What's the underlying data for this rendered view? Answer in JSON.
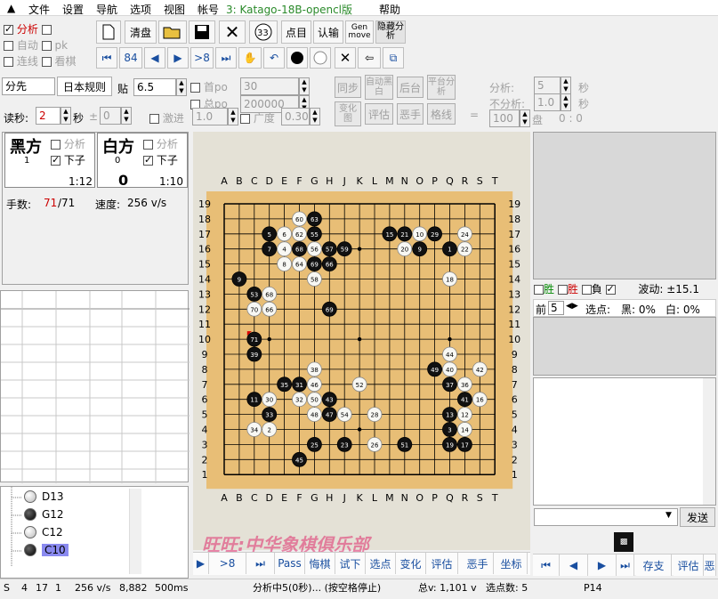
{
  "menu": {
    "file": "文件",
    "settings": "设置",
    "nav": "导航",
    "options": "选项",
    "view": "视图",
    "account": "帐号",
    "engine": "3: Katago-18B-opencl版",
    "help": "帮助"
  },
  "left_checks": {
    "analyze": "分析",
    "auto": "自动",
    "pk": "pk",
    "continuous": "连线",
    "watch": "看棋"
  },
  "toolbar": {
    "clear": "清盘",
    "score": "点目",
    "resign": "认输",
    "genmove": "Gen move",
    "hide_analysis": "隐藏分析",
    "move_num": "84",
    "to_eight": ">8"
  },
  "row2": {
    "handicap": "分先",
    "rules": "日本规则",
    "komi_label": "贴",
    "komi": "6.5",
    "first_po": "首po",
    "first_po_val": "30",
    "total_po": "总po",
    "total_po_val": "200000",
    "read_sec": "读秒:",
    "read_val": "2",
    "sec": "秒",
    "pm": "±",
    "pm_val": "0",
    "advance": "激进",
    "advance_val": "1.0",
    "breadth": "广度",
    "breadth_val": "0.30"
  },
  "row2_btns": {
    "sync": "同步",
    "auto_black": "自动黑白",
    "backstage": "后台",
    "flat_analysis": "平台分析",
    "variation": "变化图",
    "evaluate": "评估",
    "bad_move": "恶手",
    "grid": "格线"
  },
  "row2_right": {
    "analysis": "分析:",
    "analysis_val": "5",
    "sec": "秒",
    "no_analysis": "不分析:",
    "no_val": "1.0",
    "sec2": "秒",
    "games": "100",
    "games_unit": "盘",
    "score": "0 : 0"
  },
  "players": {
    "black": "黑方",
    "black_num": "1",
    "white": "白方",
    "white_num": "0",
    "analyze": "分析",
    "play": "下子",
    "black_time": "1:12",
    "black_score": "",
    "white_score": "0",
    "white_time": "1:10"
  },
  "moves": {
    "label": "手数:",
    "current": "71",
    "total": "/71",
    "speed_label": "速度:",
    "speed": "256 v/s"
  },
  "tree": [
    {
      "label": "D13",
      "color": "white"
    },
    {
      "label": "G12",
      "color": "black"
    },
    {
      "label": "C12",
      "color": "white"
    },
    {
      "label": "C10",
      "color": "black"
    }
  ],
  "coords": {
    "letters": [
      "A",
      "B",
      "C",
      "D",
      "E",
      "F",
      "G",
      "H",
      "J",
      "K",
      "L",
      "M",
      "N",
      "O",
      "P",
      "Q",
      "R",
      "S",
      "T"
    ]
  },
  "watermark": "旺旺:中华象棋俱乐部",
  "bottom_tabs": {
    "pass": "Pass",
    "undo": "悔棋",
    "try": "试下",
    "points": "选点",
    "change": "变化",
    "evaluate": "评估",
    "bad": "恶手",
    "coord": "坐标",
    "p8": ">8"
  },
  "right": {
    "win": "胜",
    "lose": "胜",
    "neg": "負",
    "wave_label": "波动:",
    "wave": "±15.1",
    "front": "前",
    "front_val": "5",
    "pick": "选点:",
    "black_pct": "黑: 0%",
    "white_pct": "白: 0%",
    "send": "发送",
    "save": "存支",
    "evaluate": "评估",
    "bad": "恶"
  },
  "status": {
    "s": "S",
    "a": "4",
    "b": "17",
    "c": "1",
    "speed": "256 v/s",
    "nodes": "8,882",
    "ms": "500ms",
    "analyzing": "分析中5(0秒)... (按空格停止)",
    "total": "总v: 1,101 v",
    "points": "选点数: 5",
    "pos": "P14"
  },
  "stones": [
    {
      "p": "F18",
      "c": "w",
      "n": "60"
    },
    {
      "p": "G18",
      "c": "b",
      "n": "63"
    },
    {
      "p": "D17",
      "c": "b",
      "n": "5"
    },
    {
      "p": "E17",
      "c": "w",
      "n": "6"
    },
    {
      "p": "F17",
      "c": "w",
      "n": "62"
    },
    {
      "p": "G17",
      "c": "b",
      "n": "55"
    },
    {
      "p": "M17",
      "c": "b",
      "n": "15"
    },
    {
      "p": "N17",
      "c": "b",
      "n": "21"
    },
    {
      "p": "O17",
      "c": "w",
      "n": "10"
    },
    {
      "p": "P17",
      "c": "b",
      "n": "29"
    },
    {
      "p": "R17",
      "c": "w",
      "n": "24"
    },
    {
      "p": "D16",
      "c": "b",
      "n": "7"
    },
    {
      "p": "E16",
      "c": "w",
      "n": "4"
    },
    {
      "p": "F16",
      "c": "b",
      "n": "68"
    },
    {
      "p": "G16",
      "c": "w",
      "n": "56"
    },
    {
      "p": "H16",
      "c": "b",
      "n": "57"
    },
    {
      "p": "J16",
      "c": "b",
      "n": "59"
    },
    {
      "p": "N16",
      "c": "w",
      "n": "20"
    },
    {
      "p": "O16",
      "c": "b",
      "n": "9"
    },
    {
      "p": "Q16",
      "c": "b",
      "n": "1"
    },
    {
      "p": "R16",
      "c": "w",
      "n": "22"
    },
    {
      "p": "E15",
      "c": "w",
      "n": "8"
    },
    {
      "p": "F15",
      "c": "w",
      "n": "64"
    },
    {
      "p": "G15",
      "c": "b",
      "n": "69"
    },
    {
      "p": "H15",
      "c": "b",
      "n": "66"
    },
    {
      "p": "B14",
      "c": "b",
      "n": "9"
    },
    {
      "p": "G14",
      "c": "w",
      "n": "58"
    },
    {
      "p": "Q14",
      "c": "w",
      "n": "18"
    },
    {
      "p": "C13",
      "c": "b",
      "n": "53"
    },
    {
      "p": "D13",
      "c": "w",
      "n": "68"
    },
    {
      "p": "C12",
      "c": "w",
      "n": "70"
    },
    {
      "p": "D12",
      "c": "w",
      "n": "66"
    },
    {
      "p": "H12",
      "c": "b",
      "n": "69"
    },
    {
      "p": "C10",
      "c": "b",
      "n": "71"
    },
    {
      "p": "C9",
      "c": "b",
      "n": "39"
    },
    {
      "p": "G8",
      "c": "w",
      "n": "38"
    },
    {
      "p": "P8",
      "c": "b",
      "n": "49"
    },
    {
      "p": "Q8",
      "c": "w",
      "n": "40"
    },
    {
      "p": "S8",
      "c": "w",
      "n": "42"
    },
    {
      "p": "Q9",
      "c": "w",
      "n": "44"
    },
    {
      "p": "E7",
      "c": "b",
      "n": "35"
    },
    {
      "p": "F7",
      "c": "b",
      "n": "31"
    },
    {
      "p": "G7",
      "c": "w",
      "n": "46"
    },
    {
      "p": "K7",
      "c": "w",
      "n": "52"
    },
    {
      "p": "Q7",
      "c": "b",
      "n": "37"
    },
    {
      "p": "R7",
      "c": "w",
      "n": "36"
    },
    {
      "p": "C6",
      "c": "b",
      "n": "11"
    },
    {
      "p": "D6",
      "c": "w",
      "n": "30"
    },
    {
      "p": "F6",
      "c": "w",
      "n": "32"
    },
    {
      "p": "G6",
      "c": "w",
      "n": "50"
    },
    {
      "p": "H6",
      "c": "b",
      "n": "43"
    },
    {
      "p": "R6",
      "c": "b",
      "n": "41"
    },
    {
      "p": "S6",
      "c": "w",
      "n": "16"
    },
    {
      "p": "D5",
      "c": "b",
      "n": "33"
    },
    {
      "p": "G5",
      "c": "w",
      "n": "48"
    },
    {
      "p": "H5",
      "c": "b",
      "n": "47"
    },
    {
      "p": "J5",
      "c": "w",
      "n": "54"
    },
    {
      "p": "L5",
      "c": "w",
      "n": "28"
    },
    {
      "p": "Q5",
      "c": "b",
      "n": "13"
    },
    {
      "p": "R5",
      "c": "w",
      "n": "12"
    },
    {
      "p": "C4",
      "c": "w",
      "n": "34"
    },
    {
      "p": "D4",
      "c": "w",
      "n": "2"
    },
    {
      "p": "Q4",
      "c": "b",
      "n": "3"
    },
    {
      "p": "R4",
      "c": "w",
      "n": "14"
    },
    {
      "p": "G3",
      "c": "b",
      "n": "25"
    },
    {
      "p": "J3",
      "c": "b",
      "n": "23"
    },
    {
      "p": "L3",
      "c": "w",
      "n": "26"
    },
    {
      "p": "N3",
      "c": "b",
      "n": "51"
    },
    {
      "p": "Q3",
      "c": "b",
      "n": "19"
    },
    {
      "p": "R3",
      "c": "b",
      "n": "17"
    },
    {
      "p": "F2",
      "c": "b",
      "n": "45"
    }
  ]
}
